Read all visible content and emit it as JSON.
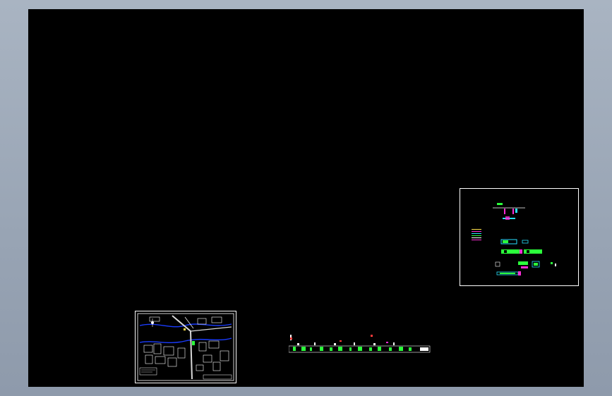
{
  "viewport": {
    "background": "#000000"
  },
  "drawings": [
    {
      "name": "site-plan-sheet",
      "frame_color": "#ffffff"
    },
    {
      "name": "detail-sheet",
      "frame_color": "#ffffff"
    },
    {
      "name": "profile-strip"
    }
  ],
  "colors": {
    "line": "#ffffff",
    "water": "#1a3cff",
    "road": "#d8d8d8",
    "green": "#2bff3b",
    "magenta": "#ff2bd6",
    "cyan": "#27e0ff",
    "yellow": "#ffe14a",
    "red": "#ff3a3a"
  }
}
